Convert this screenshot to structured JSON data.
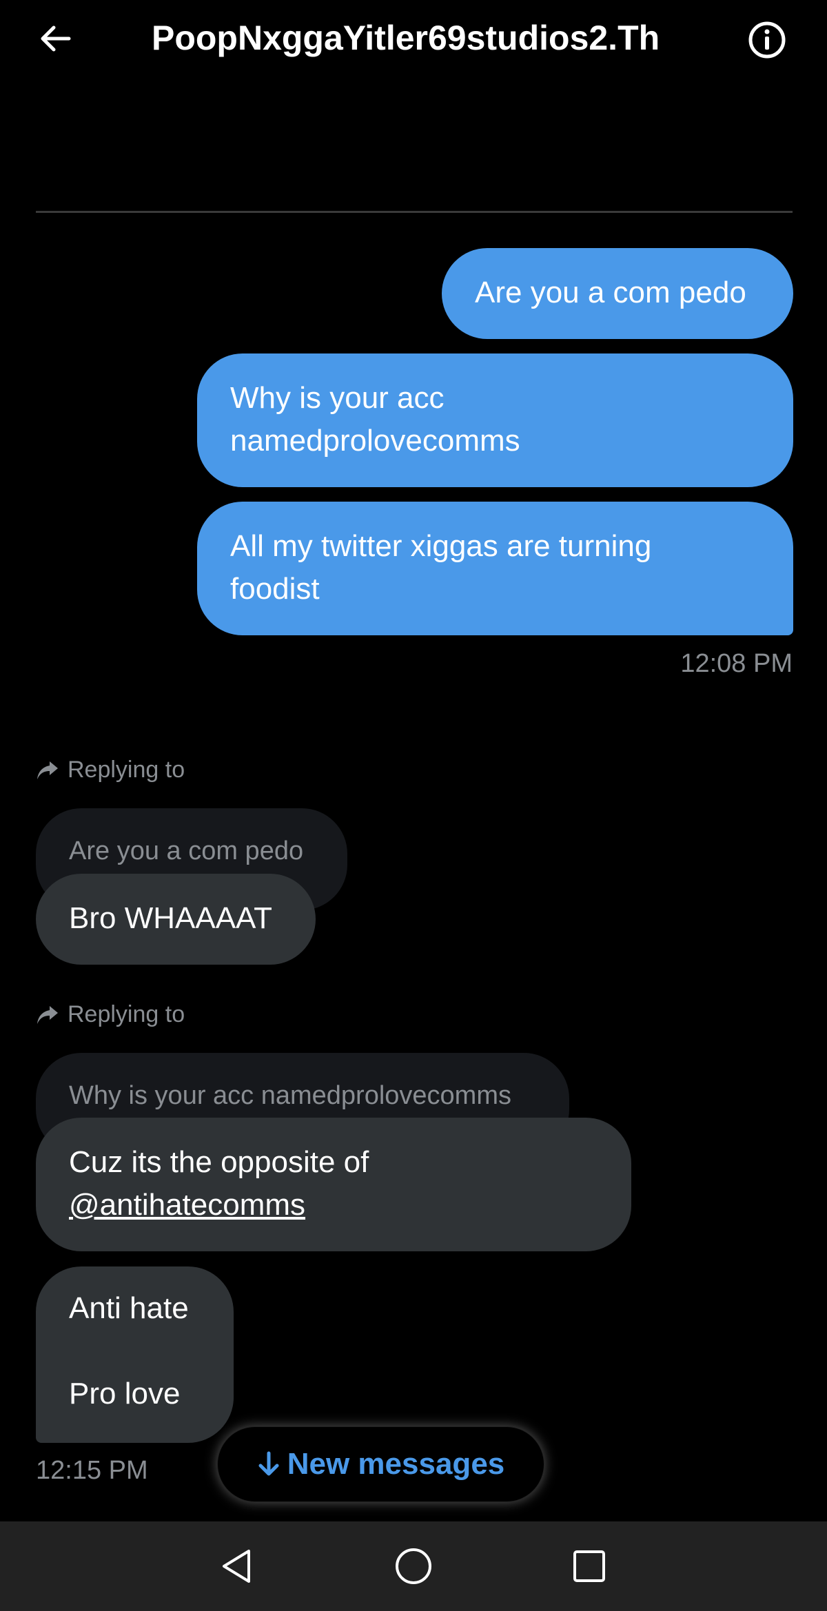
{
  "header": {
    "title": "PoopNxggaYitler69studios2.Th",
    "back_icon": "arrow-left-icon",
    "info_icon": "info-icon"
  },
  "sent_messages": [
    {
      "text": "Are you a com pedo"
    },
    {
      "text_lines": [
        "Why is your acc",
        "namedprolovecomms"
      ]
    },
    {
      "text_lines": [
        "All my twitter xiggas are turning",
        "foodist"
      ]
    }
  ],
  "sent_timestamp": "12:08 PM",
  "replies": [
    {
      "label": "Replying to",
      "quoted": "Are you a com pedo",
      "text": "Bro WHAAAAT"
    },
    {
      "label": "Replying to",
      "quoted": "Why is your acc namedprolovecomms",
      "text_prefix": "Cuz its the opposite of",
      "mention": "@antihatecomms"
    }
  ],
  "last_message": {
    "line1": "Anti hate",
    "line2": "Pro love"
  },
  "received_timestamp": "12:15 PM",
  "new_messages_button": {
    "label": "New messages",
    "icon": "arrow-down-icon"
  },
  "colors": {
    "sent_bubble": "#4a99e9",
    "received_bubble": "#2f3336",
    "accent": "#4a99e9",
    "background": "#000000"
  }
}
